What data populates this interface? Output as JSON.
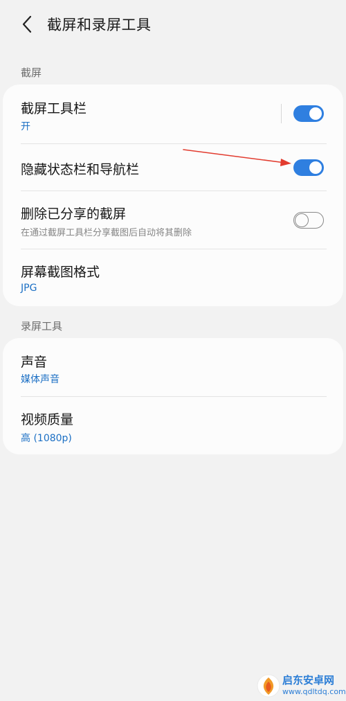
{
  "header": {
    "title": "截屏和录屏工具"
  },
  "sections": {
    "screenshot": {
      "label": "截屏",
      "items": [
        {
          "title": "截屏工具栏",
          "subtitle": "开",
          "toggle": "on"
        },
        {
          "title": "隐藏状态栏和导航栏",
          "toggle": "on"
        },
        {
          "title": "删除已分享的截屏",
          "subtitle": "在通过截屏工具栏分享截图后自动将其删除",
          "toggle": "off"
        },
        {
          "title": "屏幕截图格式",
          "subtitle": "JPG"
        }
      ]
    },
    "recording": {
      "label": "录屏工具",
      "items": [
        {
          "title": "声音",
          "subtitle": "媒体声音"
        },
        {
          "title": "视频质量",
          "subtitle": "高 (1080p)"
        }
      ]
    }
  },
  "watermark": {
    "name": "启东安卓网",
    "url": "www.qdltdq.com"
  },
  "colors": {
    "accent": "#2f7fe0",
    "link_text": "#1b6fc4",
    "annotation_arrow": "#e23b2e",
    "background": "#f2f2f2",
    "card": "#fcfcfc"
  }
}
